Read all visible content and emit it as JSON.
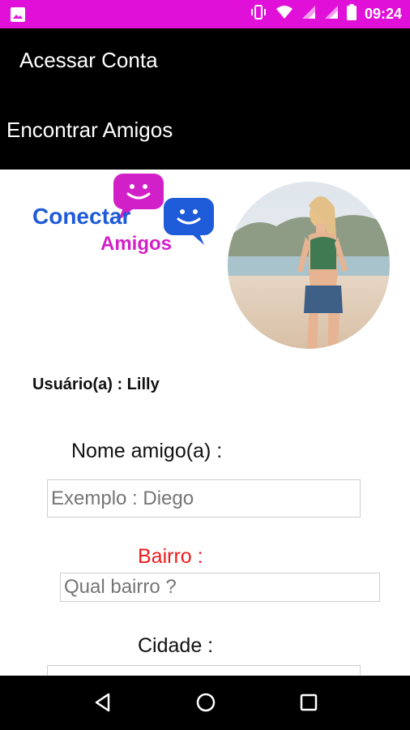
{
  "status_bar": {
    "time": "09:24",
    "color": "#e010d8",
    "icons": [
      "image-icon",
      "vibrate-icon",
      "wifi-icon",
      "signal-icon",
      "signal-icon",
      "battery-icon"
    ]
  },
  "menu": {
    "account_label": "Acessar Conta",
    "friends_label": "Encontrar Amigos"
  },
  "logo": {
    "line1": "Conectar",
    "line2": "Amigos",
    "colors": {
      "blue": "#1e5bd8",
      "magenta": "#d220c8"
    }
  },
  "user": {
    "line": "Usuário(a) : Lilly"
  },
  "form": {
    "name_label": "Nome amigo(a) :",
    "name_placeholder": "Exemplo : Diego",
    "bairro_label": "Bairro :",
    "bairro_placeholder": "Qual bairro ?",
    "cidade_label": "Cidade :",
    "bairro_color": "#ee1c1c"
  },
  "nav": {
    "icons": [
      "back-icon",
      "home-icon",
      "recents-icon"
    ]
  }
}
